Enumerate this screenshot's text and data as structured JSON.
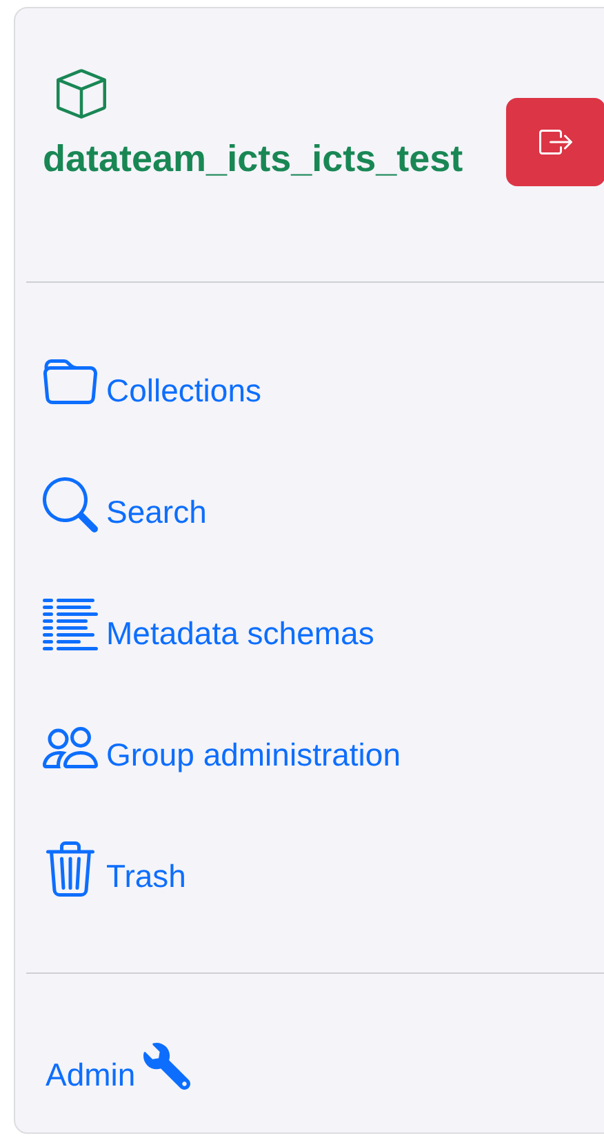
{
  "header": {
    "title": "datateam_icts_icts_test"
  },
  "nav": {
    "items": [
      {
        "kind": "collections",
        "label": "Collections"
      },
      {
        "kind": "search",
        "label": "Search"
      },
      {
        "kind": "schemas",
        "label": "Metadata schemas"
      },
      {
        "kind": "groups",
        "label": "Group administration"
      },
      {
        "kind": "trash",
        "label": "Trash"
      }
    ]
  },
  "footer": {
    "admin": {
      "label": "Admin"
    }
  }
}
